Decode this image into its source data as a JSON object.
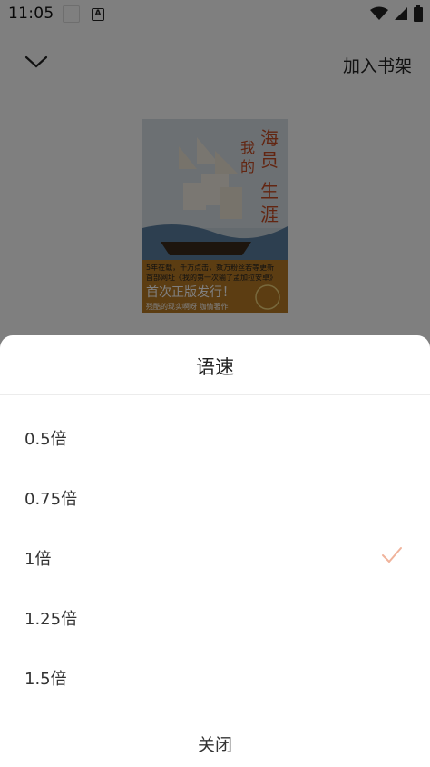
{
  "status_bar": {
    "time": "11:05"
  },
  "header": {
    "add_to_shelf": "加入书架"
  },
  "cover": {
    "title_vertical_1": "海员生涯",
    "title_vertical_2": "我的",
    "blurb": "5年在载，千万点击，数万粉丝若等更新",
    "blurb2": "首部网址《我的第一次输了孟加拉安卓》",
    "edition": "首次正版发行！",
    "footer": "残酷的现实啊呀 咖情著作"
  },
  "sheet": {
    "title": "语速",
    "options": [
      {
        "label": "0.5倍",
        "selected": false
      },
      {
        "label": "0.75倍",
        "selected": false
      },
      {
        "label": "1倍",
        "selected": true
      },
      {
        "label": "1.25倍",
        "selected": false
      },
      {
        "label": "1.5倍",
        "selected": false
      }
    ],
    "close": "关闭",
    "accent_color": "#f0b39b"
  }
}
